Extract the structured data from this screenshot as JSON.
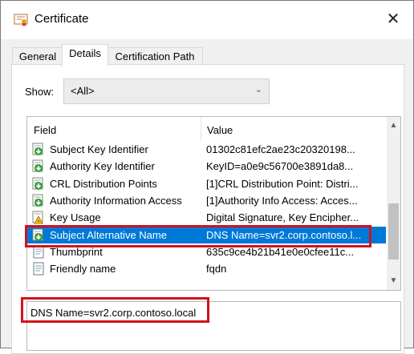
{
  "window": {
    "title": "Certificate",
    "close_glyph": "✕"
  },
  "tabs": [
    {
      "label": "General",
      "active": false
    },
    {
      "label": "Details",
      "active": true
    },
    {
      "label": "Certification Path",
      "active": false
    }
  ],
  "show": {
    "label": "Show:",
    "selected": "<All>"
  },
  "fields_table": {
    "columns": [
      "Field",
      "Value"
    ],
    "rows": [
      {
        "field": "Subject Key Identifier",
        "value": "01302c81efc2ae23c20320198...",
        "icon": "green-arrow-cert-icon"
      },
      {
        "field": "Authority Key Identifier",
        "value": "KeyID=a0e9c56700e3891da8...",
        "icon": "green-arrow-cert-icon"
      },
      {
        "field": "CRL Distribution Points",
        "value": "[1]CRL Distribution Point: Distri...",
        "icon": "green-arrow-cert-icon"
      },
      {
        "field": "Authority Information Access",
        "value": "[1]Authority Info Access: Acces...",
        "icon": "green-arrow-cert-icon"
      },
      {
        "field": "Key Usage",
        "value": "Digital Signature, Key Encipher...",
        "icon": "warning-cert-icon"
      },
      {
        "field": "Subject Alternative Name",
        "value": "DNS Name=svr2.corp.contoso.l...",
        "icon": "green-arrow-cert-icon",
        "selected": true
      },
      {
        "field": "Thumbprint",
        "value": "635c9ce4b21b41e0e0cfee11c...",
        "icon": "document-icon"
      },
      {
        "field": "Friendly name",
        "value": "fqdn",
        "icon": "document-icon"
      }
    ]
  },
  "detail": {
    "text": "DNS Name=svr2.corp.contoso.local"
  },
  "highlight_color": "#d0121d",
  "selection_color": "#0078d7"
}
